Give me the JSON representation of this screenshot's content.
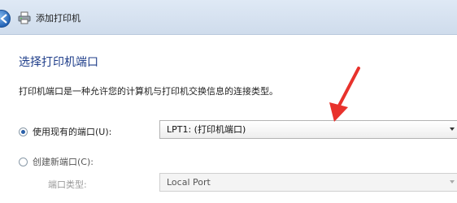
{
  "titlebar": {
    "title": "添加打印机",
    "back_icon": "back-arrow-icon",
    "app_icon": "printer-icon"
  },
  "main": {
    "heading": "选择打印机端口",
    "description": "打印机端口是一种允许您的计算机与打印机交换信息的连接类型。",
    "use_existing": {
      "label": "使用现有的端口(U):",
      "selected": true,
      "value": "LPT1: (打印机端口)"
    },
    "create_new": {
      "label": "创建新端口(C):",
      "selected": false
    },
    "port_type": {
      "label": "端口类型:",
      "value": "Local Port",
      "disabled": true
    }
  },
  "annotation": {
    "color": "#e8322c",
    "icon": "red-arrow-icon"
  },
  "colors": {
    "heading": "#1f3e8a",
    "titlebar": "#dfe9f5"
  }
}
